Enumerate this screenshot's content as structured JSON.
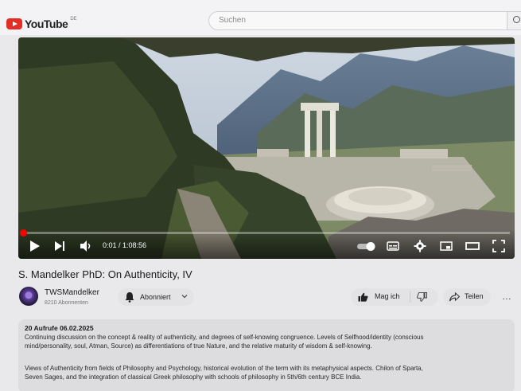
{
  "header": {
    "logo_text": "YouTube",
    "logo_region": "DE",
    "search_placeholder": "Suchen"
  },
  "player": {
    "current_time": "0:01",
    "duration": "1:08:56",
    "time_display": "0:01 / 1:08:56",
    "progress_fraction": 0.0003
  },
  "video": {
    "title": "S. Mandelker PhD: On Authenticity, IV"
  },
  "channel": {
    "name": "TWSMandelker",
    "subscribers": "8210 Abonnenten",
    "subscribe_label": "Abonniert"
  },
  "actions": {
    "like_label": "Mag ich",
    "share_label": "Teilen",
    "more_label": "…"
  },
  "description": {
    "views": "20 Aufrufe",
    "date": "06.02.2025",
    "meta": "20 Aufrufe  06.02.2025",
    "paragraph1_line1": "Continuing discussion on the concept & reality of authenticity, and degrees of self-knowing congruence. Levels of Selfhood/identity (conscious",
    "paragraph1_line2": "mind/personality, soul, Atman, Source) as differentiations of true Nature, and the relative maturity of wisdom & self-knowing.",
    "paragraph2_line1": "Views of Authenticity from fields of Philosophy and Psychology, historical evolution of the term with its metaphysical aspects. Chilon of Sparta,",
    "paragraph2_line2": "Seven Sages, and the integration of classical Greek philosophy with schools of philosophy in 5th/6th century BCE India."
  },
  "colors": {
    "accent_red": "#ff0000",
    "page_bg": "#e9e8ea"
  }
}
